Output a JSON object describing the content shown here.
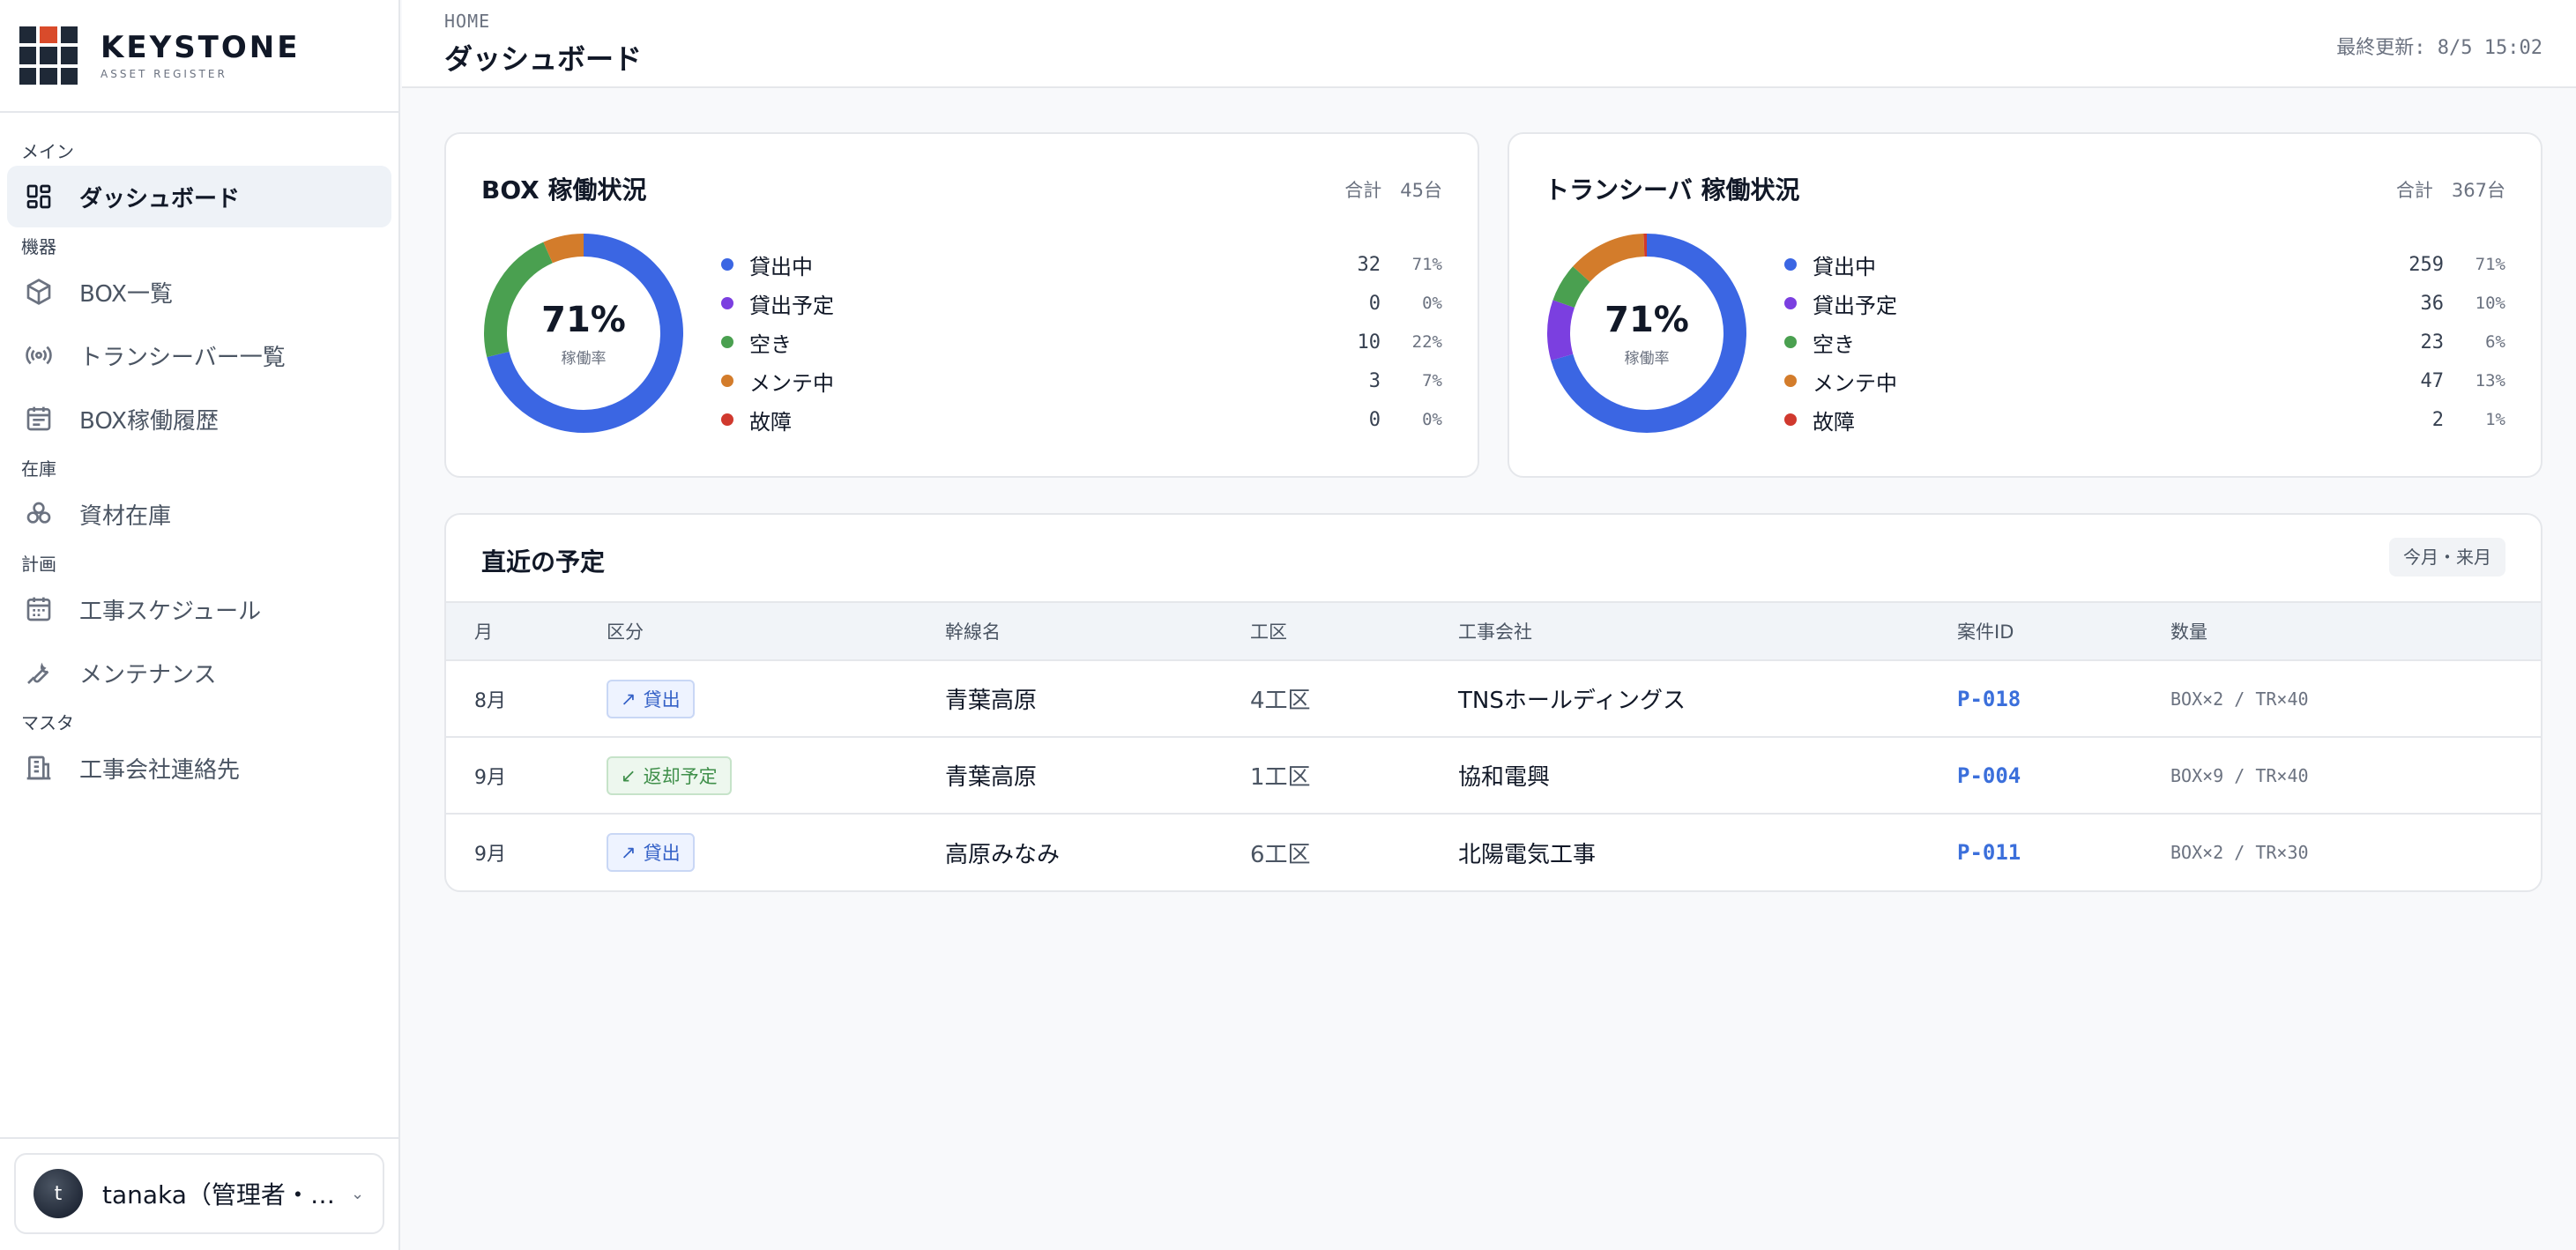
{
  "brand": {
    "name": "KEYSTONE",
    "sub": "ASSET REGISTER"
  },
  "sidebar": {
    "sections": {
      "main": "メイン",
      "equipment": "機器",
      "inventory": "在庫",
      "planning": "計画",
      "master": "マスタ"
    },
    "items": {
      "dashboard": "ダッシュボード",
      "box_list": "BOX一覧",
      "transceiver_list": "トランシーバー一覧",
      "box_history": "BOX稼働履歴",
      "materials": "資材在庫",
      "schedule": "工事スケジュール",
      "maintenance": "メンテナンス",
      "contractors": "工事会社連絡先"
    }
  },
  "user": {
    "initial": "t",
    "name": "tanaka（管理者・tanaka）"
  },
  "header": {
    "breadcrumb": "HOME",
    "title": "ダッシュボード",
    "updated": "最終更新: 8/5 15:02"
  },
  "colors": {
    "lent": "#3b66e3",
    "planned": "#7b3fe0",
    "free": "#4aa050",
    "maint": "#d37c2b",
    "broken": "#d0392e"
  },
  "box": {
    "title": "BOX 稼働状況",
    "total": "合計　45台",
    "center_pct": "71%",
    "center_label": "稼働率",
    "legend": [
      {
        "label": "貸出中",
        "count": "32",
        "pct": "71%",
        "value": 32,
        "color": "#3b66e3"
      },
      {
        "label": "貸出予定",
        "count": "0",
        "pct": "0%",
        "value": 0,
        "color": "#7b3fe0"
      },
      {
        "label": "空き",
        "count": "10",
        "pct": "22%",
        "value": 10,
        "color": "#4aa050"
      },
      {
        "label": "メンテ中",
        "count": "3",
        "pct": "7%",
        "value": 3,
        "color": "#d37c2b"
      },
      {
        "label": "故障",
        "count": "0",
        "pct": "0%",
        "value": 0,
        "color": "#d0392e"
      }
    ]
  },
  "transceiver": {
    "title": "トランシーバ 稼働状況",
    "total": "合計　367台",
    "center_pct": "71%",
    "center_label": "稼働率",
    "legend": [
      {
        "label": "貸出中",
        "count": "259",
        "pct": "71%",
        "value": 259,
        "color": "#3b66e3"
      },
      {
        "label": "貸出予定",
        "count": "36",
        "pct": "10%",
        "value": 36,
        "color": "#7b3fe0"
      },
      {
        "label": "空き",
        "count": "23",
        "pct": "6%",
        "value": 23,
        "color": "#4aa050"
      },
      {
        "label": "メンテ中",
        "count": "47",
        "pct": "13%",
        "value": 47,
        "color": "#d37c2b"
      },
      {
        "label": "故障",
        "count": "2",
        "pct": "1%",
        "value": 2,
        "color": "#d0392e"
      }
    ]
  },
  "schedule": {
    "title": "直近の予定",
    "range": "今月・来月",
    "columns": [
      "月",
      "区分",
      "幹線名",
      "工区",
      "工事会社",
      "案件ID",
      "数量"
    ],
    "rows": [
      {
        "month": "8月",
        "type": "貸出",
        "type_arrow": "↗",
        "kind": "lend",
        "line": "青葉高原",
        "zone": "4工区",
        "company": "TNSホールディングス",
        "pid": "P-018",
        "qty": "BOX×2 / TR×40"
      },
      {
        "month": "9月",
        "type": "返却予定",
        "type_arrow": "↙",
        "kind": "ret",
        "line": "青葉高原",
        "zone": "1工区",
        "company": "協和電興",
        "pid": "P-004",
        "qty": "BOX×9 / TR×40"
      },
      {
        "month": "9月",
        "type": "貸出",
        "type_arrow": "↗",
        "kind": "lend",
        "line": "高原みなみ",
        "zone": "6工区",
        "company": "北陽電気工事",
        "pid": "P-011",
        "qty": "BOX×2 / TR×30"
      }
    ]
  }
}
